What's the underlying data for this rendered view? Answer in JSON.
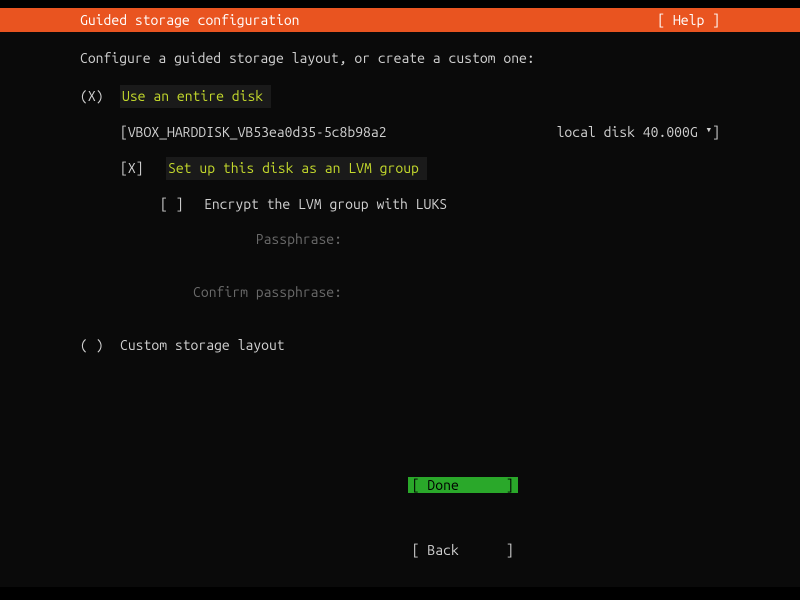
{
  "header": {
    "title": "Guided storage configuration",
    "help": "[ Help ]"
  },
  "prompt": "Configure a guided storage layout, or create a custom one:",
  "options": {
    "use_entire_disk": {
      "marker": "(X)",
      "label": "Use an entire disk"
    },
    "custom": {
      "marker": "( )",
      "label": "Custom storage layout"
    }
  },
  "disk": {
    "open": "[",
    "name": " VBOX_HARDDISK_VB53ea0d35-5c8b98a2",
    "info": "local disk 40.000G ",
    "arrow": "▾",
    "close": " ]"
  },
  "lvm": {
    "marker": "[X]",
    "label": "Set up this disk as an LVM group"
  },
  "encrypt": {
    "marker": "[ ]",
    "label": "Encrypt the LVM group with LUKS"
  },
  "passphrase": {
    "label": "Passphrase:"
  },
  "confirm_passphrase": {
    "label": "Confirm passphrase:"
  },
  "buttons": {
    "done_open": "[ ",
    "done": "Done",
    "done_close": "      ]",
    "back_open": "[ ",
    "back": "Back",
    "back_close": "      ]"
  }
}
